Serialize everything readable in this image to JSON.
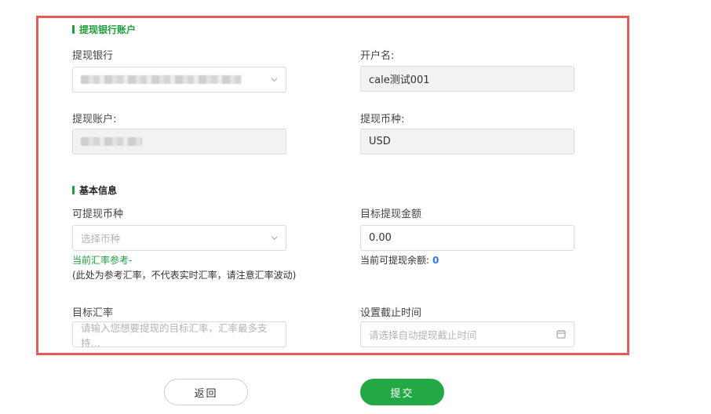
{
  "bank_section": {
    "title": "提现银行账户",
    "bank_label": "提现银行",
    "account_name_label": "开户名:",
    "account_name_value": "cale测试001",
    "account_label": "提现账户:",
    "currency_label": "提现币种:",
    "currency_value": "USD"
  },
  "basic_section": {
    "title": "基本信息",
    "available_currency_label": "可提现币种",
    "available_currency_placeholder": "选择币种",
    "target_amount_label": "目标提现金额",
    "target_amount_value": "0.00",
    "rate_ref_label": "当前汇率参考-",
    "rate_note": "(此处为参考汇率，不代表实时汇率，请注意汇率波动)",
    "balance_label": "当前可提现余额:",
    "balance_value": "0",
    "target_rate_label": "目标汇率",
    "target_rate_placeholder": "请输入您想要提现的目标汇率，汇率最多支持...",
    "deadline_label": "设置截止时间",
    "deadline_placeholder": "请选择自动提现截止时间"
  },
  "actions": {
    "back_label": "返回",
    "submit_label": "提交"
  },
  "colors": {
    "accent_green": "#1e9e3d",
    "highlight_border": "#e55a5a",
    "balance_blue": "#2f7be0"
  }
}
